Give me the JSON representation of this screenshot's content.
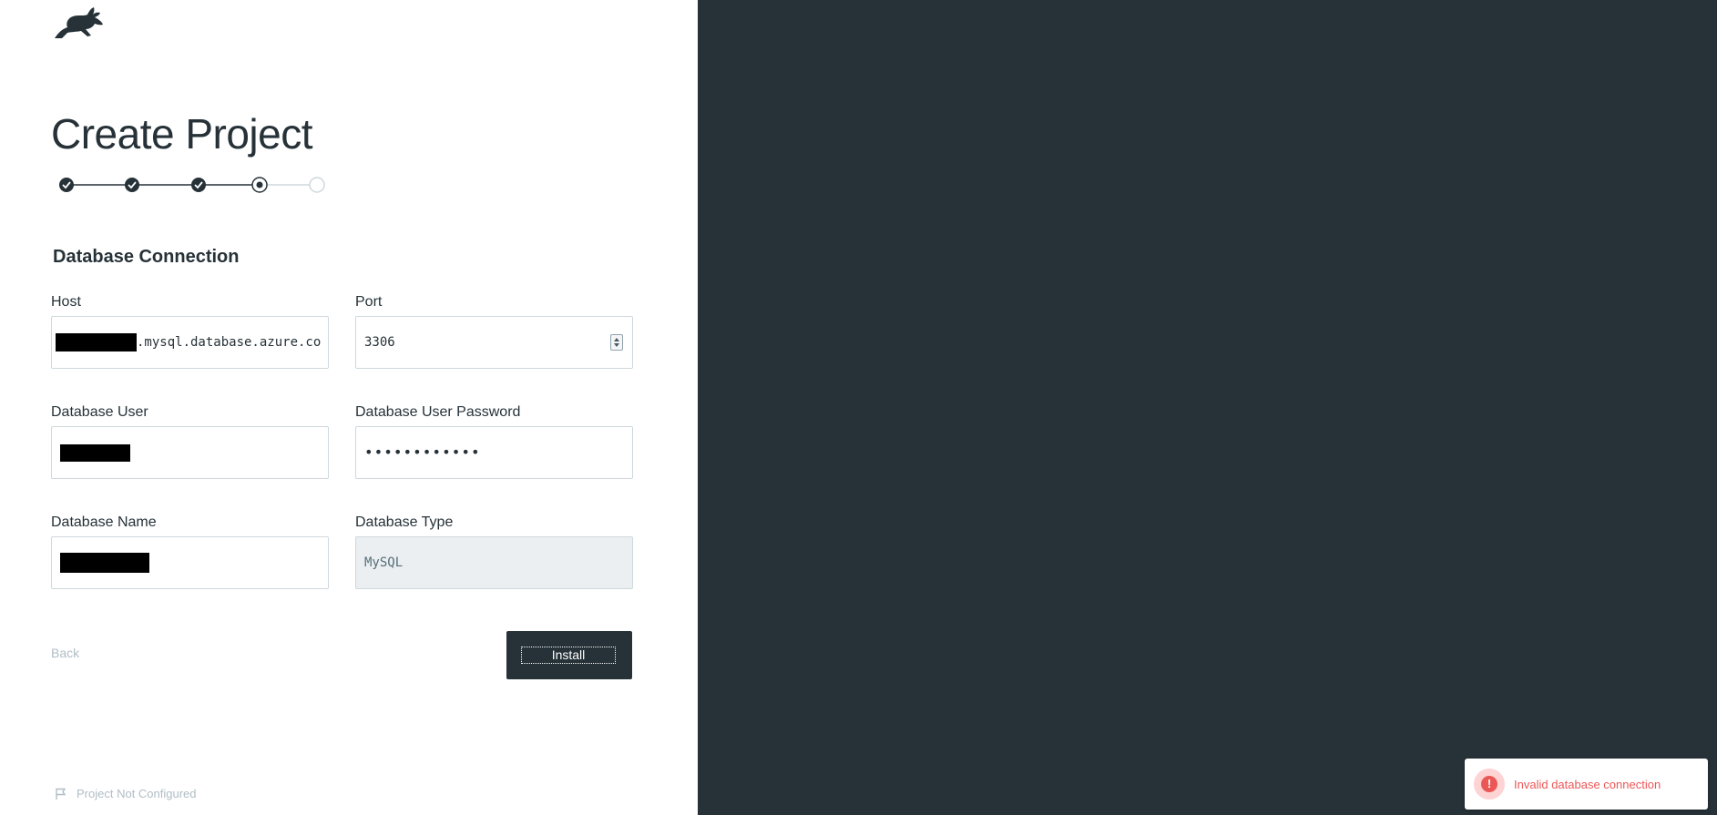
{
  "page": {
    "title": "Create Project",
    "section_title": "Database Connection"
  },
  "stepper": {
    "current_step": 4,
    "total_steps": 5,
    "steps": [
      {
        "state": "complete"
      },
      {
        "state": "complete"
      },
      {
        "state": "complete"
      },
      {
        "state": "current"
      },
      {
        "state": "pending"
      }
    ]
  },
  "form": {
    "host": {
      "label": "Host",
      "value_suffix": ".mysql.database.azure.co"
    },
    "port": {
      "label": "Port",
      "value": "3306"
    },
    "db_user": {
      "label": "Database User"
    },
    "db_password": {
      "label": "Database User Password",
      "masked": "••••••••••••"
    },
    "db_name": {
      "label": "Database Name"
    },
    "db_type": {
      "label": "Database Type",
      "value": "MySQL"
    }
  },
  "actions": {
    "back_label": "Back",
    "install_label": "Install"
  },
  "footer": {
    "status": "Project Not Configured"
  },
  "toast": {
    "message": "Invalid database connection",
    "icon_symbol": "!"
  },
  "colors": {
    "dark_panel": "#263238",
    "error": "#eb5757",
    "muted": "#b0bec5"
  }
}
